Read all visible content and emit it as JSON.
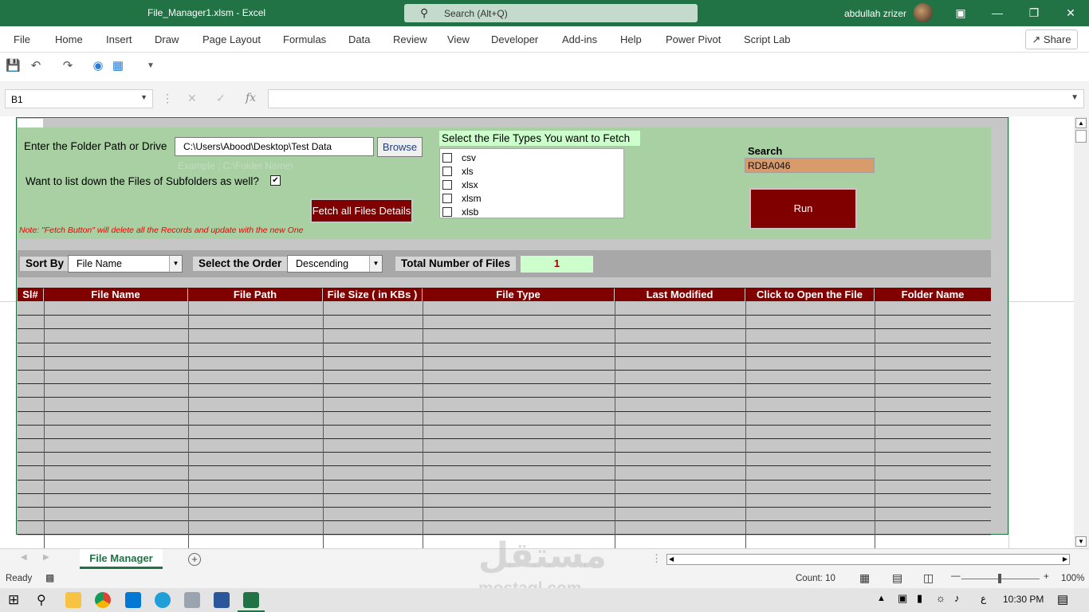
{
  "titlebar": {
    "file_title": "File_Manager1.xlsm  -  Excel",
    "search_placeholder": "Search (Alt+Q)",
    "user_name": "abdullah zrizer"
  },
  "menu": {
    "items": [
      "File",
      "Home",
      "Insert",
      "Draw",
      "Page Layout",
      "Formulas",
      "Data",
      "Review",
      "View",
      "Developer",
      "Add-ins",
      "Help",
      "Power Pivot",
      "Script Lab"
    ],
    "share_label": "Share"
  },
  "formula_bar": {
    "name_box": "B1",
    "fx_label": "fx",
    "formula": ""
  },
  "form": {
    "folder_label": "Enter the Folder Path or Drive",
    "folder_value": "C:\\Users\\Abood\\Desktop\\Test Data",
    "browse_label": "Browse",
    "folder_hint": "Example : C:\\Folder Name\\",
    "subfolders_label": "Want to list down the Files of Subfolders as well?",
    "subfolders_checked": "✔",
    "fetch_label": "Fetch all Files Details",
    "note": "Note:  \"Fetch Button\" will delete all the Records and update with the new One",
    "filetypes_title": "Select the File Types You want to Fetch",
    "filetypes": [
      "csv",
      "xls",
      "xlsx",
      "xlsm",
      "xlsb"
    ],
    "search_label": "Search",
    "search_value": "RDBA046",
    "run_label": "Run"
  },
  "sortbar": {
    "sort_by_label": "Sort By",
    "sort_by_value": "File Name",
    "order_label": "Select the Order",
    "order_value": "Descending",
    "total_label": "Total Number of Files",
    "total_value": "1"
  },
  "table": {
    "headers": [
      "Sl#",
      "File Name",
      "File Path",
      "File Size ( in KBs )",
      "File Type",
      "Last Modified",
      "Click to Open the File",
      "Folder Name"
    ]
  },
  "sheet_tabs": {
    "active": "File Manager"
  },
  "statusbar": {
    "ready": "Ready",
    "count": "Count: 10",
    "zoom": "100%"
  },
  "taskbar": {
    "lang": "ع",
    "time": "10:30 PM"
  },
  "watermark": {
    "arabic": "مستقل",
    "latin": "mostaql.com"
  },
  "colors": {
    "excel_green": "#217346",
    "maroon": "#800000",
    "panel_green": "#a9d0a3",
    "light_green": "#ccffcc",
    "search_fill": "#d99a6c"
  }
}
